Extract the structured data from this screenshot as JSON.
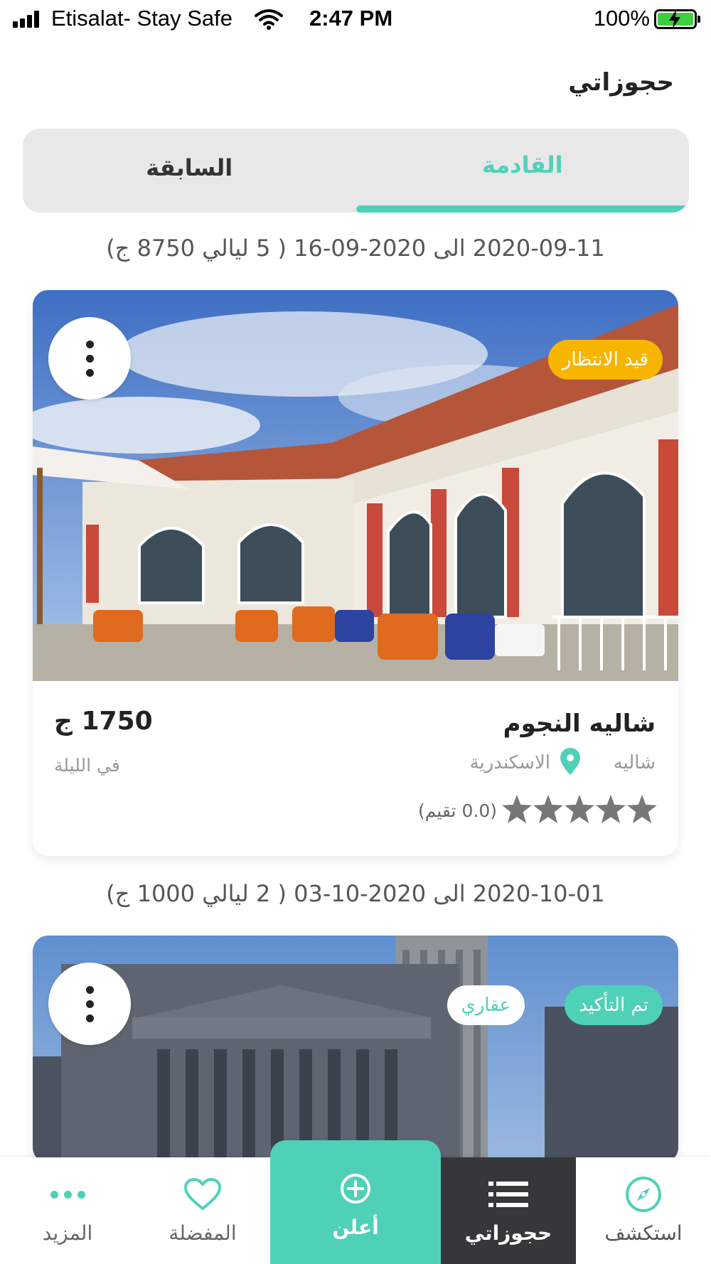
{
  "status_bar": {
    "carrier": "Etisalat- Stay Safe",
    "time": "2:47 PM",
    "battery_percent": "100%",
    "battery_level": 1.0
  },
  "header": {
    "title": "حجوزاتي"
  },
  "tabs": {
    "upcoming": "القادمة",
    "previous": "السابقة",
    "active": "upcoming"
  },
  "bookings": [
    {
      "date_range": "2020-09-11 الى 2020-09-16 ( 5 ليالي 8750 ج)",
      "status_badge": "قيد الانتظار",
      "name": "شاليه النجوم",
      "type": "شاليه",
      "city": "الاسكندرية",
      "rating_text": "(0.0 تقيم)",
      "rating": 0.0,
      "price": "1750 ج",
      "price_unit": "في الليلة"
    },
    {
      "date_range": "2020-10-01 الى 2020-10-03 ( 2 ليالي 1000 ج)",
      "status_badge": "تم التأكيد",
      "category_badge": "عقاري"
    }
  ],
  "bottom_nav": {
    "explore": "استكشف",
    "bookings": "حجوزاتي",
    "advertise": "أعلن",
    "favorites": "المفضلة",
    "more": "المزيد",
    "active": "bookings"
  },
  "colors": {
    "accent": "#4fd1b8",
    "pending": "#f7b500",
    "nav_active_bg": "#37373a"
  }
}
